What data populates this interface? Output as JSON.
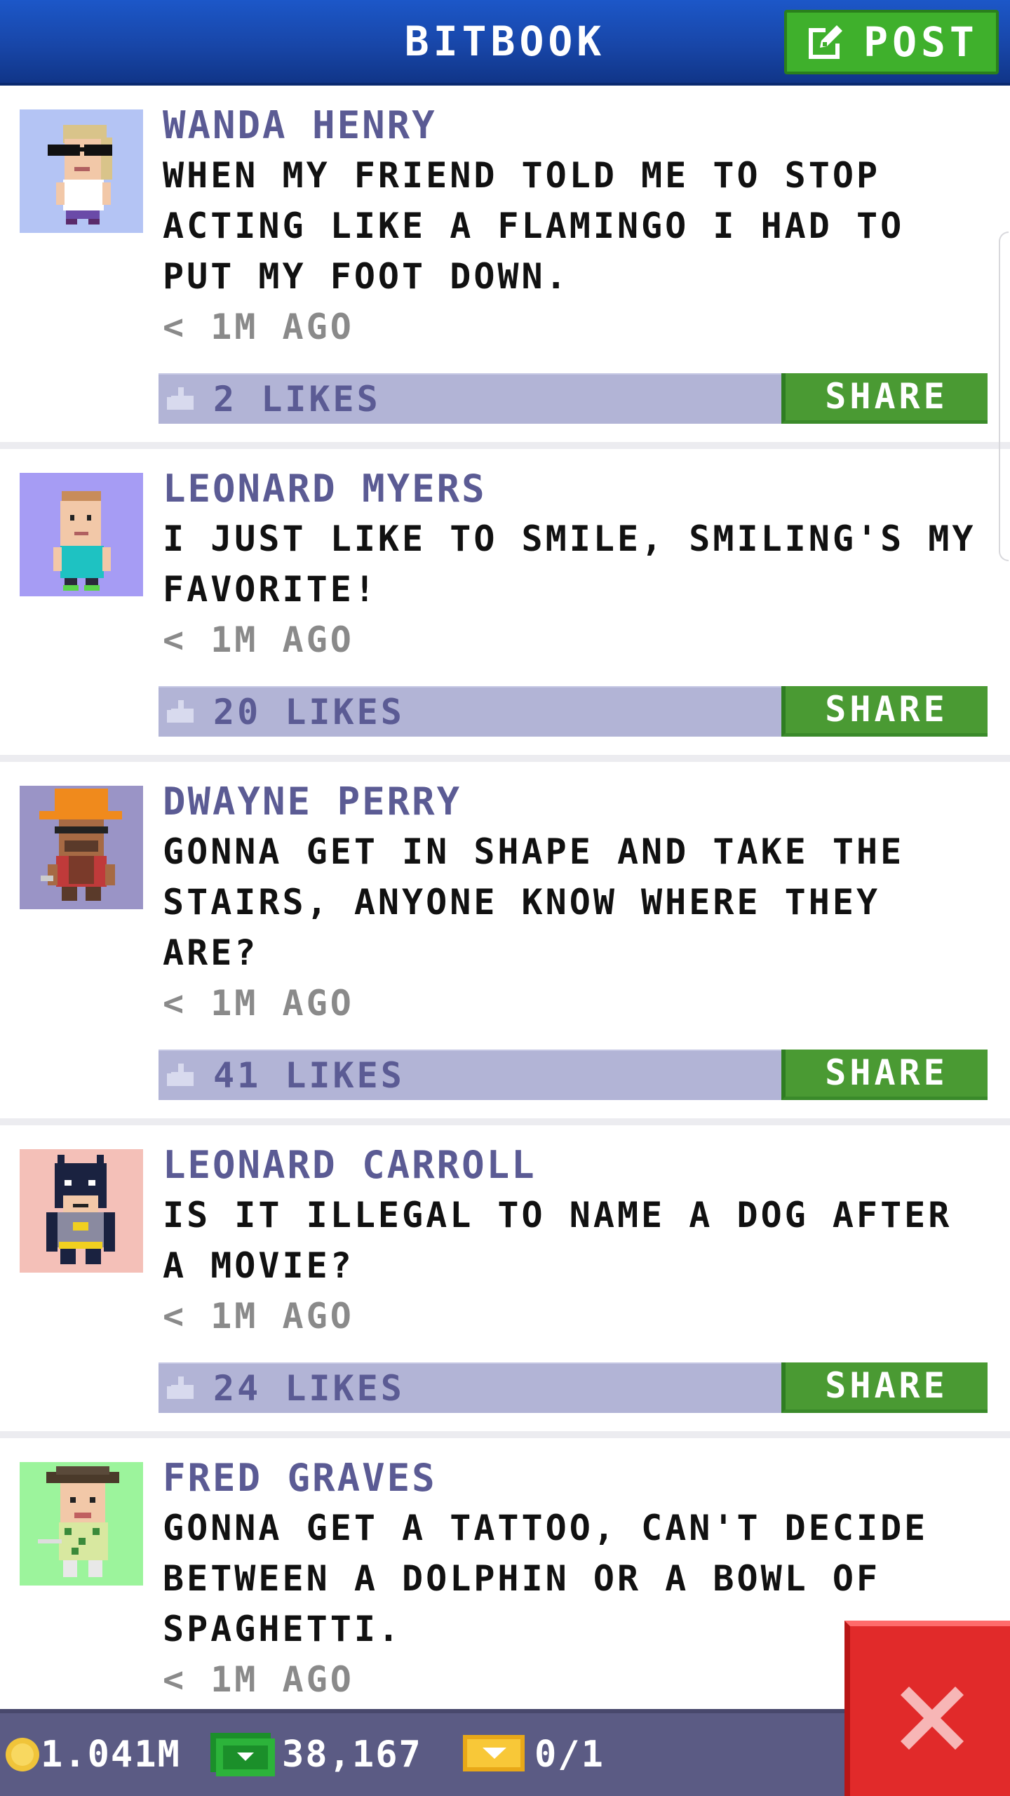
{
  "header": {
    "title": "BITBOOK",
    "post_label": "POST"
  },
  "posts": [
    {
      "author": "WANDA HENRY",
      "message": "WHEN MY FRIEND TOLD ME TO STOP ACTING LIKE A FLAMINGO I HAD TO PUT MY FOOT DOWN.",
      "time": "< 1M AGO",
      "likes": "2 LIKES",
      "share": "SHARE",
      "avatar_icon": "avatar-sunglasses-blonde",
      "avatar_bg": "#b4c4f4"
    },
    {
      "author": "LEONARD MYERS",
      "message": "I JUST LIKE TO SMILE, SMILING'S MY FAVORITE!",
      "time": "< 1M AGO",
      "likes": "20 LIKES",
      "share": "SHARE",
      "avatar_icon": "avatar-teal-shirt",
      "avatar_bg": "#a69cf4"
    },
    {
      "author": "DWAYNE PERRY",
      "message": "GONNA GET IN SHAPE AND TAKE THE STAIRS, ANYONE KNOW WHERE THEY ARE?",
      "time": "< 1M AGO",
      "likes": "41 LIKES",
      "share": "SHARE",
      "avatar_icon": "avatar-hardhat-worker",
      "avatar_bg": "#9a94c6"
    },
    {
      "author": "LEONARD CARROLL",
      "message": "IS IT ILLEGAL TO NAME A DOG AFTER A MOVIE?",
      "time": "< 1M AGO",
      "likes": "24 LIKES",
      "share": "SHARE",
      "avatar_icon": "avatar-bat-hero",
      "avatar_bg": "#f4c0b8"
    },
    {
      "author": "FRED GRAVES",
      "message": "GONNA GET A TATTOO, CAN'T DECIDE BETWEEN A DOLPHIN OR A BOWL OF SPAGHETTI.",
      "time": "< 1M AGO",
      "likes": "",
      "share": "",
      "avatar_icon": "avatar-golfer-cap",
      "avatar_bg": "#9cf49c"
    }
  ],
  "status": {
    "coins": "1.041M",
    "bux": "38,167",
    "vip": "0/1"
  },
  "colors": {
    "header_blue": "#1846a8",
    "post_green": "#3fb02c",
    "share_green": "#4a9a33",
    "likes_bar": "#b2b4d6",
    "author_purple": "#5b5b94",
    "close_red": "#e12a2a",
    "status_bar": "#5b5b84"
  }
}
